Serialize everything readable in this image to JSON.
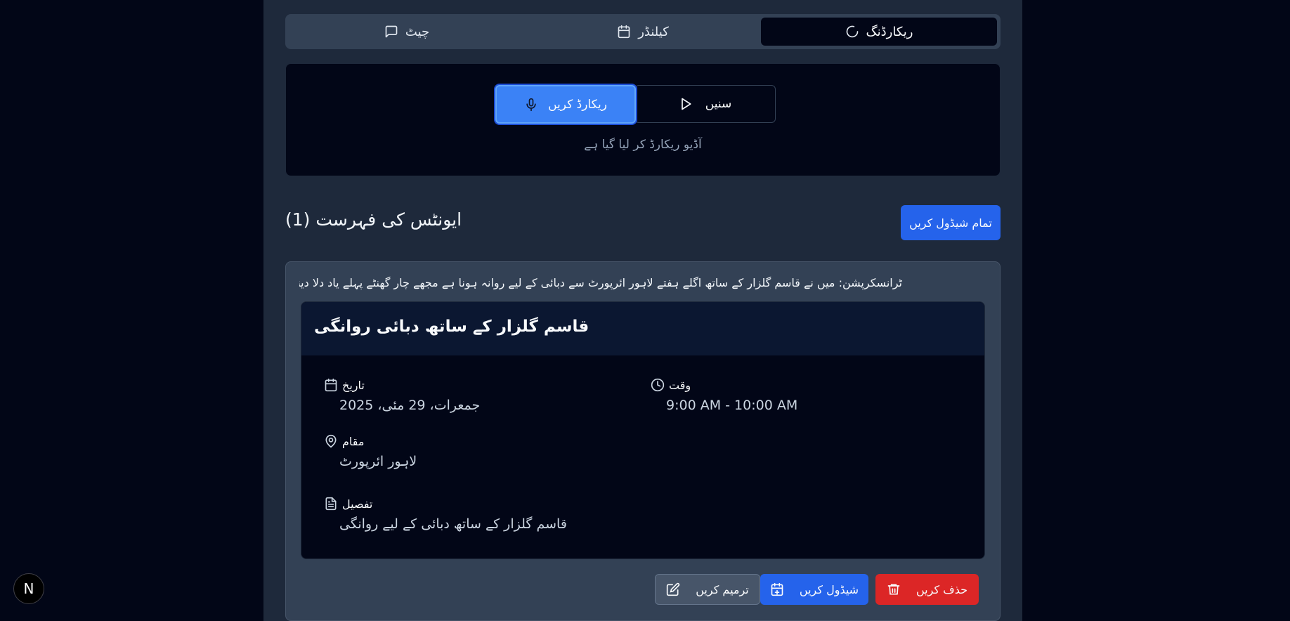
{
  "tabs": [
    {
      "label": "ریکارڈنگ",
      "icon": "loader-icon",
      "active": true
    },
    {
      "label": "کیلنڈر",
      "icon": "calendar-icon",
      "active": false
    },
    {
      "label": "چیٹ",
      "icon": "message-icon",
      "active": false
    }
  ],
  "recorder": {
    "record_label": "ریکارڈ کریں",
    "listen_label": "سنیں",
    "status": "آڈیو ریکارڈ کر لیا گیا ہے"
  },
  "events": {
    "title": "ایونٹس کی فہرست (1)",
    "schedule_all_label": "تمام شیڈول کریں"
  },
  "event": {
    "transcript": "ٹرانسکرپشن: میں نے قاسم گلزار کے ساتھ اگلے ہفتے لاہور ائرپورٹ سے دبائی کے لیے روانہ ہونا ہے مجھے چار گھنٹے پہلے یاد دلا دینا",
    "title": "قاسم گلزار کے ساتھ دبائی روانگی",
    "date_label": "تاریخ",
    "date_value": "جمعرات، 29 مئی، 2025",
    "time_label": "وقت",
    "time_value": "9:00 AM - 10:00 AM",
    "location_label": "مقام",
    "location_value": "لاہور ائرپورٹ",
    "description_label": "تفصیل",
    "description_value": "قاسم گلزار کے ساتھ دبائی کے لیے روانگی",
    "edit_label": "ترمیم کریں",
    "schedule_label": "شیڈول کریں",
    "delete_label": "حذف کریں"
  },
  "badge": {
    "letter": "N"
  }
}
